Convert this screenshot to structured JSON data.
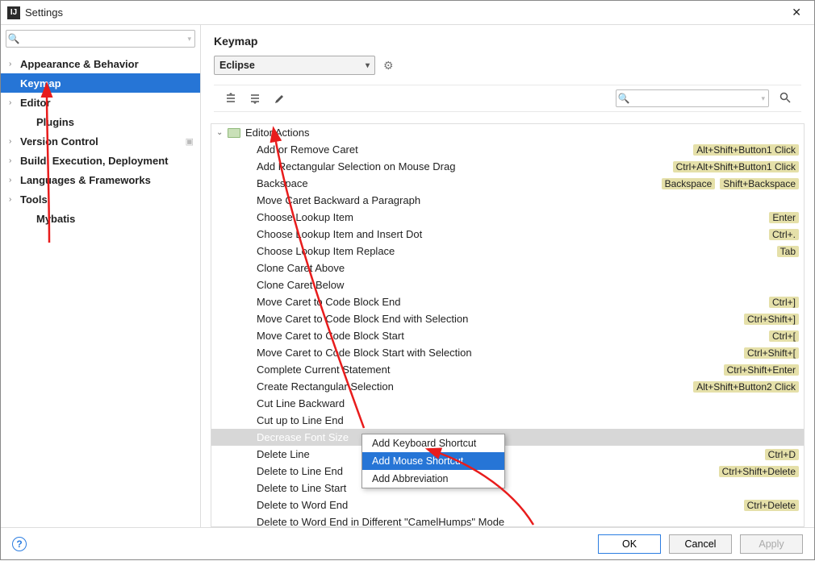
{
  "window": {
    "title": "Settings"
  },
  "sidebar": {
    "search_placeholder": "",
    "items": [
      {
        "label": "Appearance & Behavior",
        "expandable": true,
        "bold": true
      },
      {
        "label": "Keymap",
        "expandable": false,
        "bold": true,
        "selected": true
      },
      {
        "label": "Editor",
        "expandable": true,
        "bold": true
      },
      {
        "label": "Plugins",
        "expandable": false,
        "bold": true,
        "child": true
      },
      {
        "label": "Version Control",
        "expandable": true,
        "bold": true,
        "pin": true
      },
      {
        "label": "Build, Execution, Deployment",
        "expandable": true,
        "bold": true
      },
      {
        "label": "Languages & Frameworks",
        "expandable": true,
        "bold": true
      },
      {
        "label": "Tools",
        "expandable": true,
        "bold": true
      },
      {
        "label": "Mybatis",
        "expandable": false,
        "bold": true,
        "child": true
      }
    ]
  },
  "main": {
    "title": "Keymap",
    "scheme": "Eclipse",
    "search_placeholder": "",
    "group": "Editor Actions",
    "actions": [
      {
        "name": "Add or Remove Caret",
        "shortcuts": [
          "Alt+Shift+Button1 Click"
        ]
      },
      {
        "name": "Add Rectangular Selection on Mouse Drag",
        "shortcuts": [
          "Ctrl+Alt+Shift+Button1 Click"
        ]
      },
      {
        "name": "Backspace",
        "shortcuts": [
          "Backspace",
          "Shift+Backspace"
        ]
      },
      {
        "name": "Move Caret Backward a Paragraph",
        "shortcuts": []
      },
      {
        "name": "Choose Lookup Item",
        "shortcuts": [
          "Enter"
        ]
      },
      {
        "name": "Choose Lookup Item and Insert Dot",
        "shortcuts": [
          "Ctrl+."
        ]
      },
      {
        "name": "Choose Lookup Item Replace",
        "shortcuts": [
          "Tab"
        ]
      },
      {
        "name": "Clone Caret Above",
        "shortcuts": []
      },
      {
        "name": "Clone Caret Below",
        "shortcuts": []
      },
      {
        "name": "Move Caret to Code Block End",
        "shortcuts": [
          "Ctrl+]"
        ]
      },
      {
        "name": "Move Caret to Code Block End with Selection",
        "shortcuts": [
          "Ctrl+Shift+]"
        ]
      },
      {
        "name": "Move Caret to Code Block Start",
        "shortcuts": [
          "Ctrl+["
        ]
      },
      {
        "name": "Move Caret to Code Block Start with Selection",
        "shortcuts": [
          "Ctrl+Shift+["
        ]
      },
      {
        "name": "Complete Current Statement",
        "shortcuts": [
          "Ctrl+Shift+Enter"
        ]
      },
      {
        "name": "Create Rectangular Selection",
        "shortcuts": [
          "Alt+Shift+Button2 Click"
        ]
      },
      {
        "name": "Cut Line Backward",
        "shortcuts": []
      },
      {
        "name": "Cut up to Line End",
        "shortcuts": []
      },
      {
        "name": "Decrease Font Size",
        "shortcuts": [],
        "selected": true
      },
      {
        "name": "Delete Line",
        "shortcuts": [
          "Ctrl+D"
        ]
      },
      {
        "name": "Delete to Line End",
        "shortcuts": [
          "Ctrl+Shift+Delete"
        ]
      },
      {
        "name": "Delete to Line Start",
        "shortcuts": []
      },
      {
        "name": "Delete to Word End",
        "shortcuts": [
          "Ctrl+Delete"
        ]
      },
      {
        "name": "Delete to Word End in Different \"CamelHumps\" Mode",
        "shortcuts": []
      }
    ]
  },
  "context_menu": {
    "items": [
      {
        "label": "Add Keyboard Shortcut"
      },
      {
        "label": "Add Mouse Shortcut",
        "selected": true
      },
      {
        "label": "Add Abbreviation"
      }
    ]
  },
  "footer": {
    "ok": "OK",
    "cancel": "Cancel",
    "apply": "Apply"
  }
}
